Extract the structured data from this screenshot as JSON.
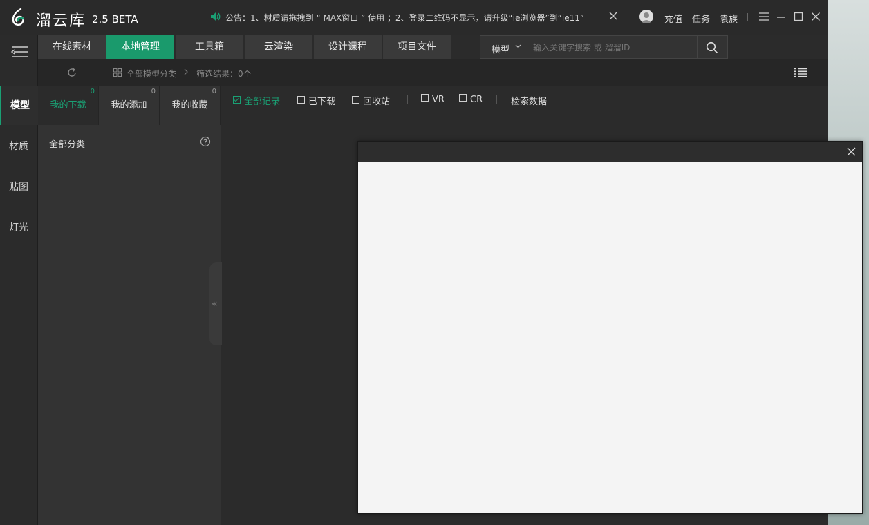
{
  "app": {
    "name": "溜云库",
    "version": "2.5 BETA"
  },
  "notice": {
    "text": "公告：1、材质请拖拽到 “ MAX窗口 ” 使用 ；2、登录二维码不显示，请升级“ie浏览器”到“ie11”"
  },
  "top_links": {
    "recharge": "充值",
    "tasks": "任务",
    "username": "袁族"
  },
  "rail": {
    "items": [
      {
        "label": "模型",
        "active": true
      },
      {
        "label": "材质",
        "active": false
      },
      {
        "label": "贴图",
        "active": false
      },
      {
        "label": "灯光",
        "active": false
      }
    ]
  },
  "nav_tabs": [
    {
      "label": "在线素材",
      "active": false
    },
    {
      "label": "本地管理",
      "active": true
    },
    {
      "label": "工具箱",
      "active": false
    },
    {
      "label": "云渲染",
      "active": false
    },
    {
      "label": "设计课程",
      "active": false
    },
    {
      "label": "项目文件",
      "active": false
    }
  ],
  "search": {
    "category": "模型",
    "placeholder": "输入关键字搜索 或 溜溜ID"
  },
  "toolbar": {
    "breadcrumb_all": "全部模型分类",
    "filter_result": "筛选结果：0个"
  },
  "sub_tabs": [
    {
      "label": "我的下载",
      "count": "0",
      "active": true
    },
    {
      "label": "我的添加",
      "count": "0",
      "active": false
    },
    {
      "label": "我的收藏",
      "count": "0",
      "active": false
    }
  ],
  "category": {
    "all_label": "全部分类"
  },
  "filters": {
    "all_records": "全部记录",
    "downloaded": "已下载",
    "recycle_bin": "回收站",
    "vr": "VR",
    "cr": "CR",
    "search_data": "检索数据"
  },
  "colors": {
    "accent": "#1a9a6c",
    "accent_text": "#1aa074",
    "background": "#2b2b2b"
  }
}
